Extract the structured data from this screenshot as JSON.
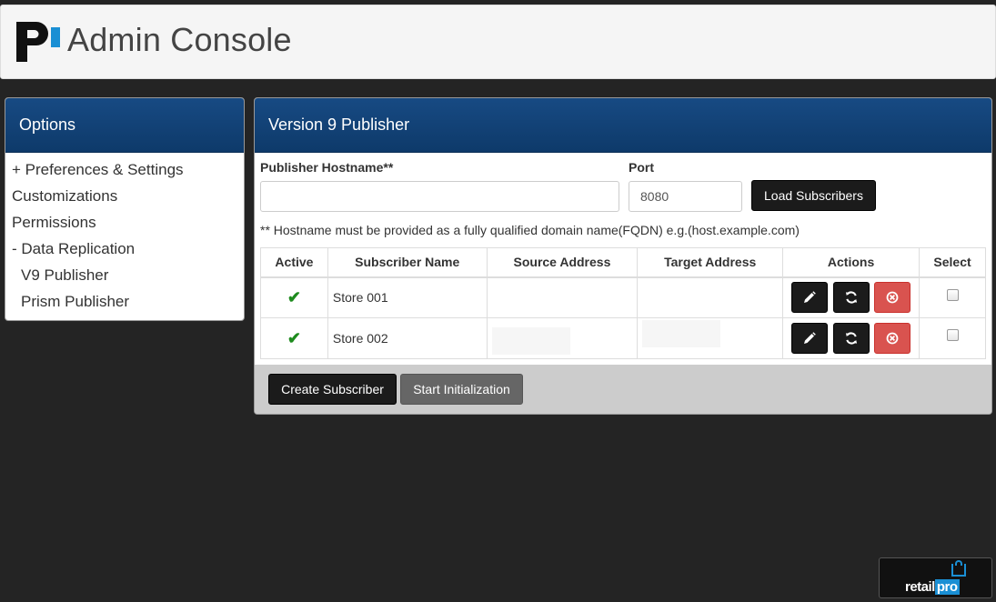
{
  "header": {
    "title": "Admin Console"
  },
  "options_panel": {
    "title": "Options",
    "items": [
      {
        "label": "+ Preferences & Settings",
        "indent": false
      },
      {
        "label": "Customizations",
        "indent": false
      },
      {
        "label": "Permissions",
        "indent": false
      },
      {
        "label": "- Data Replication",
        "indent": false
      },
      {
        "label": "V9 Publisher",
        "indent": true
      },
      {
        "label": "Prism Publisher",
        "indent": true
      }
    ]
  },
  "publisher_panel": {
    "title": "Version 9 Publisher",
    "hostname_label": "Publisher Hostname**",
    "hostname_value": "",
    "port_label": "Port",
    "port_value": "8080",
    "load_button": "Load Subscribers",
    "note": "** Hostname must be provided as a fully qualified domain name(FQDN) e.g.(host.example.com)",
    "table": {
      "headers": [
        "Active",
        "Subscriber Name",
        "Source Address",
        "Target Address",
        "Actions",
        "Select"
      ],
      "rows": [
        {
          "active": "✔",
          "name": "Store 001",
          "source": "",
          "target": ""
        },
        {
          "active": "✔",
          "name": "Store 002",
          "source": "",
          "target": ""
        }
      ]
    },
    "create_button": "Create Subscriber",
    "init_button": "Start Initialization"
  },
  "brand": {
    "retail": "retail",
    "pro": "pro"
  },
  "colors": {
    "header_blue": "#174a83",
    "accent_blue": "#1a8fd4",
    "danger": "#d9534f",
    "check_green": "#1e8b1e"
  }
}
